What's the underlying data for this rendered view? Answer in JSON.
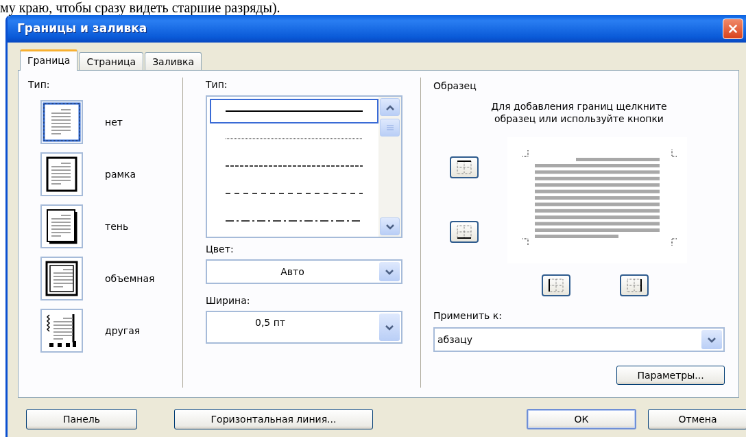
{
  "background_text": "му краю,  чтобы сразу видеть старшие разряды).",
  "window": {
    "title": "Границы и заливка"
  },
  "tabs": [
    {
      "label": "Граница",
      "selected": true
    },
    {
      "label": "Страница",
      "selected": false
    },
    {
      "label": "Заливка",
      "selected": false
    }
  ],
  "border_types": {
    "label": "Тип:",
    "items": [
      {
        "label": "нет",
        "kind": "none",
        "selected": true
      },
      {
        "label": "рамка",
        "kind": "box",
        "selected": false
      },
      {
        "label": "тень",
        "kind": "shadow",
        "selected": false
      },
      {
        "label": "объемная",
        "kind": "volume",
        "selected": false
      },
      {
        "label": "другая",
        "kind": "custom",
        "selected": false
      }
    ]
  },
  "line_style": {
    "label": "Тип:",
    "items": [
      {
        "kind": "solid",
        "selected": true
      },
      {
        "kind": "dotted",
        "selected": false
      },
      {
        "kind": "dashed",
        "selected": false
      },
      {
        "kind": "longdash",
        "selected": false
      },
      {
        "kind": "dashdot",
        "selected": false
      }
    ]
  },
  "color": {
    "label": "Цвет:",
    "value": "Авто"
  },
  "width": {
    "label": "Ширина:",
    "value": "0,5 пт"
  },
  "preview": {
    "title": "Образец",
    "hint": "Для добавления границ щелкните\nобразец или используйте кнопки"
  },
  "apply_to": {
    "label": "Применить к:",
    "value": "абзацу"
  },
  "options_button": {
    "label": "Параметры..."
  },
  "footer_buttons": [
    {
      "label": "Панель",
      "default": false
    },
    {
      "label": "Горизонтальная линия...",
      "default": false
    },
    {
      "label": "ОК",
      "default": true
    },
    {
      "label": "Отмена",
      "default": false
    }
  ]
}
